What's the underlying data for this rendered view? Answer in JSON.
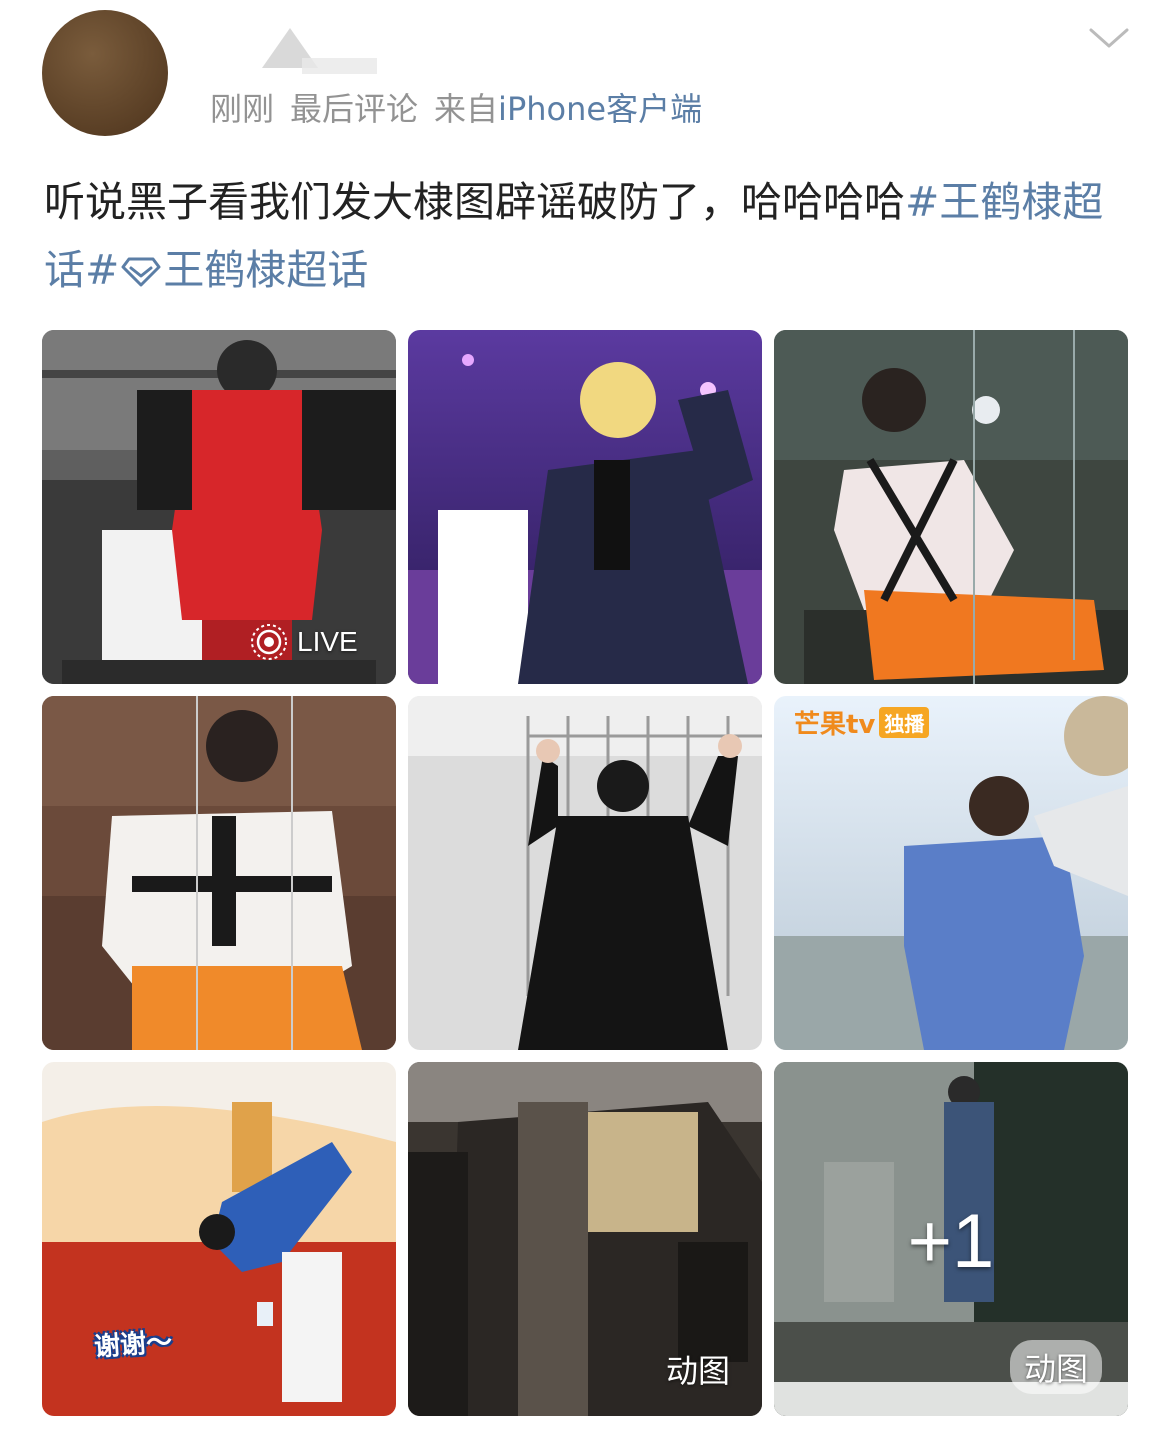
{
  "post": {
    "timestamp": "刚刚",
    "last_comment": "最后评论",
    "source_prefix": "来自",
    "source_client": "iPhone客户端",
    "text_main": "听说黑子看我们发大棣图辟谣破防了，哈哈哈哈",
    "topic_1": "#王鹤棣超话#",
    "topic_2": "王鹤棣超话"
  },
  "icons": {
    "menu": "chevron-down-icon",
    "topic": "diamond-icon",
    "live": "live-photo-icon"
  },
  "images": {
    "live_label": "LIVE",
    "gif_label_1": "动图",
    "gif_label_2": "动图",
    "more_count": "+1",
    "mango_brand": "芒果tv",
    "mango_tag": "独播",
    "thanks_caption": "谢谢～"
  },
  "colors": {
    "link": "#5b7ea6",
    "meta": "#939393",
    "text": "#222222"
  }
}
